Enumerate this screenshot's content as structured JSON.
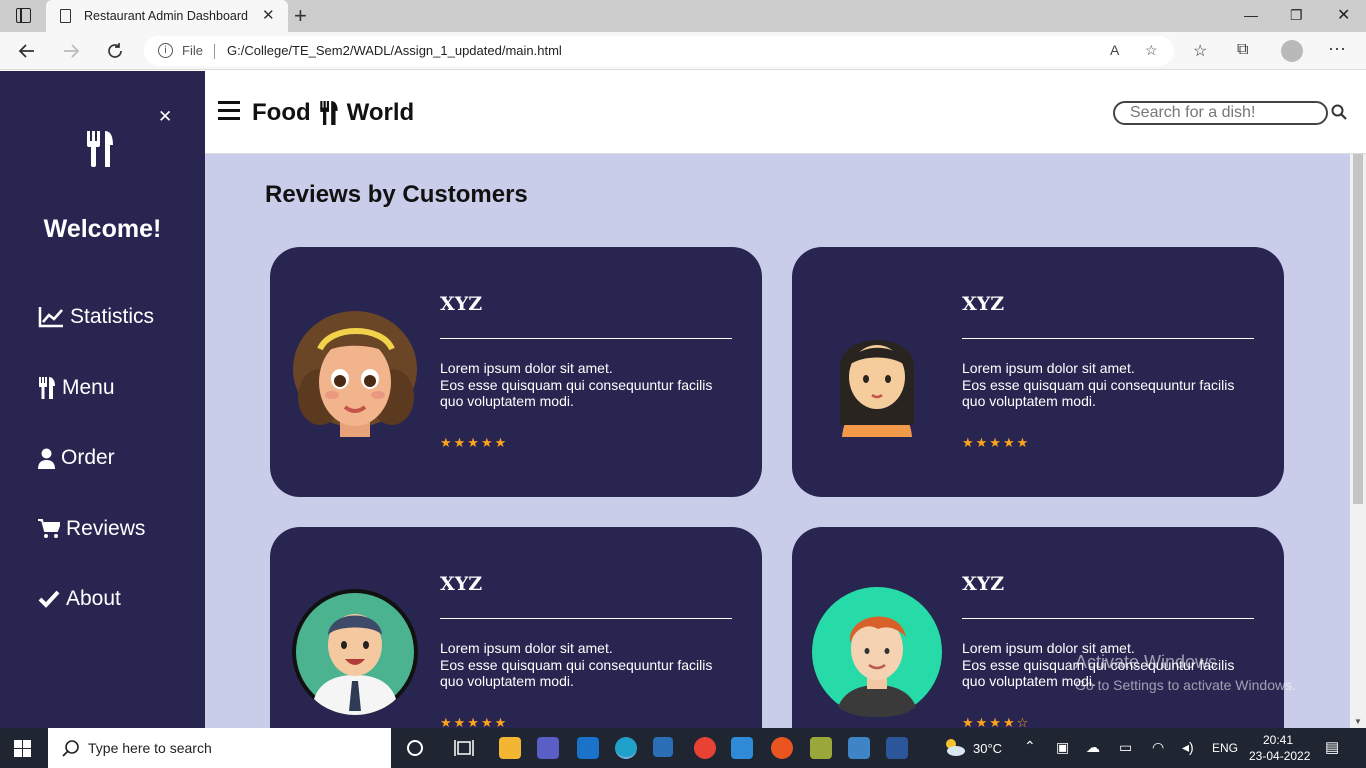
{
  "browser": {
    "tab_title": "Restaurant Admin Dashboard",
    "address_file_label": "File",
    "url": "G:/College/TE_Sem2/WADL/Assign_1_updated/main.html"
  },
  "sidebar": {
    "welcome": "Welcome!",
    "items": [
      {
        "label": "Statistics",
        "icon": "chart-line-icon"
      },
      {
        "label": "Menu",
        "icon": "utensils-icon"
      },
      {
        "label": "Order",
        "icon": "user-icon"
      },
      {
        "label": "Reviews",
        "icon": "cart-icon"
      },
      {
        "label": "About",
        "icon": "check-icon"
      }
    ]
  },
  "header": {
    "brand_left": "Food",
    "brand_right": "World",
    "search_placeholder": "Search for a dish!"
  },
  "main": {
    "title": "Reviews by Customers",
    "reviews": [
      {
        "name": "XYZ",
        "line1": "Lorem ipsum dolor sit amet.",
        "line2": "Eos esse quisquam qui consequuntur facilis",
        "line3": "quo voluptatem modi.",
        "stars": "★★★★★",
        "rating": 5
      },
      {
        "name": "XYZ",
        "line1": "Lorem ipsum dolor sit amet.",
        "line2": "Eos esse quisquam qui consequuntur facilis",
        "line3": "quo voluptatem modi.",
        "stars": "★★★★★",
        "rating": 5
      },
      {
        "name": "XYZ",
        "line1": "Lorem ipsum dolor sit amet.",
        "line2": "Eos esse quisquam qui consequuntur facilis",
        "line3": "quo voluptatem modi.",
        "stars": "★★★★★",
        "rating": 5
      },
      {
        "name": "XYZ",
        "line1": "Lorem ipsum dolor sit amet.",
        "line2": "Eos esse quisquam qui consequuntur facilis",
        "line3": "quo voluptatem modi.",
        "stars": "★★★★☆",
        "rating": 4
      }
    ]
  },
  "windows_watermark": {
    "line1": "Activate Windows",
    "line2": "Go to Settings to activate Windows."
  },
  "taskbar": {
    "search_placeholder": "Type here to search",
    "weather": "30°C",
    "language": "ENG",
    "time": "20:41",
    "date": "23-04-2022"
  },
  "colors": {
    "sidebar_bg": "#282651",
    "main_bg": "#cacdea",
    "card_bg": "#282651",
    "star": "#ffa41b"
  }
}
